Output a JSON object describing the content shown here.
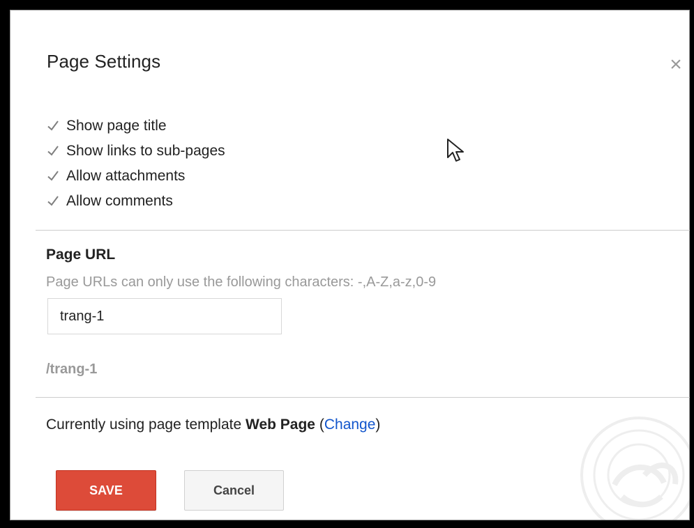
{
  "dialog": {
    "title": "Page Settings",
    "close_icon": "close-icon"
  },
  "options": [
    {
      "label": "Show page title",
      "checked": true
    },
    {
      "label": "Show links to sub-pages",
      "checked": true
    },
    {
      "label": "Allow attachments",
      "checked": true
    },
    {
      "label": "Allow comments",
      "checked": true
    }
  ],
  "page_url": {
    "title": "Page URL",
    "hint": "Page URLs can only use the following characters: -,A-Z,a-z,0-9",
    "value": "trang-1",
    "preview": "/trang-1"
  },
  "template": {
    "prefix": "Currently using page template",
    "name": "Web Page",
    "open_paren": "(",
    "change_label": "Change",
    "close_paren": ")"
  },
  "buttons": {
    "save": "SAVE",
    "cancel": "Cancel"
  },
  "colors": {
    "save": "#dd4b39",
    "link": "#1155cc",
    "muted": "#999999"
  },
  "icons": {
    "checkbox": "checkmark-icon",
    "cursor": "mouse-pointer-icon",
    "watermark": "stamp-watermark"
  }
}
